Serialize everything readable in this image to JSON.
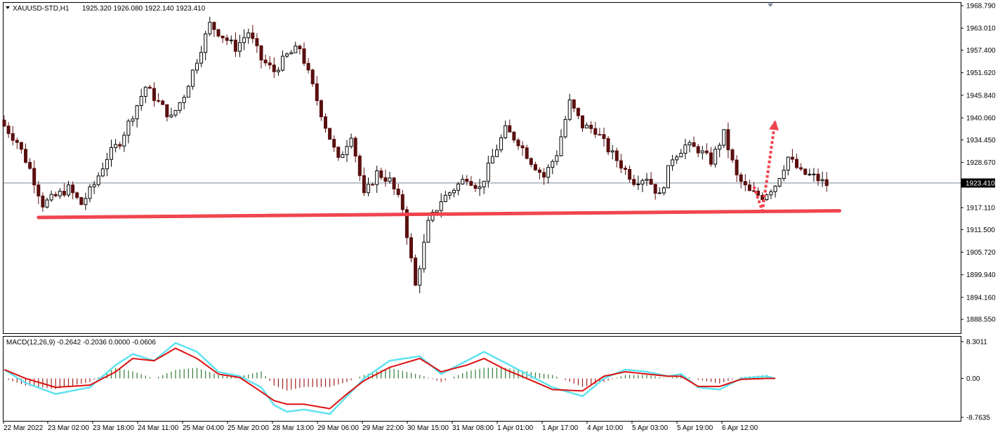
{
  "header": {
    "symbol": "XAUUSD-STD,H1",
    "ohlc": "1925.320 1926.080 1922.140 1923.410"
  },
  "macd_panel": {
    "label": "MACD(12,26,9) -0.2642 -0.2036 0.0000 -0.0606",
    "ticks": [
      "8.3011",
      "0.00",
      "-8.7635"
    ],
    "tick_values": [
      8.3011,
      0.0,
      -8.7635
    ]
  },
  "colors": {
    "bull": "#000000",
    "bear": "#5a0f0f",
    "support": "#f0454f",
    "macd_line": "#5fe3f0",
    "signal_line": "#dd1010",
    "hist_pos": "#2e7d32",
    "hist_neg": "#a32020",
    "price_line": "#7a8899"
  },
  "chart_data": {
    "type": "candlestick",
    "symbol": "XAUUSD-STD",
    "timeframe": "H1",
    "ylim": [
      1885.0,
      1969.5
    ],
    "y_ticks": [
      "1968.790",
      "1963.010",
      "1957.400",
      "1951.620",
      "1945.840",
      "1940.060",
      "1934.450",
      "1928.670",
      "1917.110",
      "1911.500",
      "1905.720",
      "1899.940",
      "1894.160",
      "1888.550"
    ],
    "y_tick_values": [
      1968.79,
      1963.01,
      1957.4,
      1951.62,
      1945.84,
      1940.06,
      1934.45,
      1928.67,
      1917.11,
      1911.5,
      1905.72,
      1899.94,
      1894.16,
      1888.55
    ],
    "current_price": "1923.410",
    "current_price_value": 1923.41,
    "x_labels": [
      "22 Mar 2022",
      "23 Mar 02:00",
      "23 Mar 18:00",
      "24 Mar 11:00",
      "25 Mar 04:00",
      "25 Mar 20:00",
      "28 Mar 13:00",
      "29 Mar 06:00",
      "29 Mar 22:00",
      "30 Mar 15:00",
      "31 Mar 08:00",
      "1 Apr 01:00",
      "1 Apr 17:00",
      "4 Apr 10:00",
      "5 Apr 03:00",
      "5 Apr 19:00",
      "6 Apr 12:00"
    ],
    "close_path": [
      [
        0,
        1938
      ],
      [
        3,
        1934
      ],
      [
        6,
        1927
      ],
      [
        9,
        1918
      ],
      [
        12,
        1920
      ],
      [
        15,
        1922
      ],
      [
        18,
        1918
      ],
      [
        21,
        1923
      ],
      [
        24,
        1930
      ],
      [
        27,
        1934
      ],
      [
        30,
        1941
      ],
      [
        33,
        1948
      ],
      [
        36,
        1944
      ],
      [
        39,
        1940
      ],
      [
        42,
        1946
      ],
      [
        45,
        1955
      ],
      [
        48,
        1964
      ],
      [
        51,
        1961
      ],
      [
        54,
        1958
      ],
      [
        57,
        1962
      ],
      [
        60,
        1955
      ],
      [
        63,
        1952
      ],
      [
        66,
        1956
      ],
      [
        69,
        1958
      ],
      [
        72,
        1948
      ],
      [
        75,
        1938
      ],
      [
        78,
        1929
      ],
      [
        81,
        1936
      ],
      [
        84,
        1920
      ],
      [
        87,
        1926
      ],
      [
        90,
        1924
      ],
      [
        93,
        1917
      ],
      [
        96,
        1897
      ],
      [
        99,
        1913
      ],
      [
        102,
        1919
      ],
      [
        105,
        1922
      ],
      [
        108,
        1925
      ],
      [
        111,
        1922
      ],
      [
        114,
        1930
      ],
      [
        117,
        1937
      ],
      [
        120,
        1934
      ],
      [
        123,
        1929
      ],
      [
        126,
        1925
      ],
      [
        129,
        1931
      ],
      [
        132,
        1944
      ],
      [
        135,
        1938
      ],
      [
        138,
        1937
      ],
      [
        141,
        1932
      ],
      [
        144,
        1928
      ],
      [
        147,
        1924
      ],
      [
        150,
        1925
      ],
      [
        153,
        1920
      ],
      [
        156,
        1930
      ],
      [
        159,
        1933
      ],
      [
        162,
        1932
      ],
      [
        165,
        1929
      ],
      [
        168,
        1936
      ],
      [
        171,
        1925
      ],
      [
        174,
        1921
      ],
      [
        177,
        1920
      ],
      [
        180,
        1923
      ],
      [
        183,
        1930
      ],
      [
        186,
        1926
      ],
      [
        189,
        1925
      ],
      [
        192,
        1923
      ]
    ],
    "support_line": {
      "start": [
        8,
        1914.6
      ],
      "end": [
        195,
        1916.3
      ]
    },
    "arrow_path": [
      [
        175,
        1922.5
      ],
      [
        177,
        1916.3
      ],
      [
        180,
        1939.5
      ]
    ],
    "macd": [
      [
        0,
        2
      ],
      [
        5,
        -1
      ],
      [
        12,
        -3.5
      ],
      [
        20,
        -2
      ],
      [
        26,
        3
      ],
      [
        30,
        5.5
      ],
      [
        35,
        4
      ],
      [
        40,
        8
      ],
      [
        45,
        6
      ],
      [
        50,
        1.5
      ],
      [
        55,
        0.5
      ],
      [
        60,
        -2
      ],
      [
        63,
        -6
      ],
      [
        66,
        -7.5
      ],
      [
        70,
        -7
      ],
      [
        76,
        -8
      ],
      [
        80,
        -4
      ],
      [
        84,
        0
      ],
      [
        90,
        4
      ],
      [
        97,
        5
      ],
      [
        102,
        1
      ],
      [
        108,
        4
      ],
      [
        112,
        6
      ],
      [
        117,
        3.5
      ],
      [
        122,
        1
      ],
      [
        128,
        -2
      ],
      [
        135,
        -4
      ],
      [
        140,
        0
      ],
      [
        145,
        2
      ],
      [
        150,
        1.5
      ],
      [
        155,
        0.5
      ],
      [
        158,
        1
      ],
      [
        162,
        -2
      ],
      [
        167,
        -2.5
      ],
      [
        172,
        0
      ],
      [
        178,
        0.5
      ],
      [
        180,
        0
      ]
    ],
    "signal": [
      [
        0,
        2
      ],
      [
        5,
        0
      ],
      [
        12,
        -2
      ],
      [
        20,
        -1.5
      ],
      [
        26,
        1.5
      ],
      [
        30,
        4.5
      ],
      [
        35,
        4
      ],
      [
        40,
        6.8
      ],
      [
        45,
        4.5
      ],
      [
        50,
        1
      ],
      [
        55,
        0.2
      ],
      [
        60,
        -3
      ],
      [
        63,
        -5
      ],
      [
        66,
        -5.8
      ],
      [
        70,
        -5.8
      ],
      [
        76,
        -6.8
      ],
      [
        80,
        -3.5
      ],
      [
        84,
        -0.5
      ],
      [
        90,
        2.5
      ],
      [
        97,
        4.5
      ],
      [
        102,
        1.5
      ],
      [
        108,
        3
      ],
      [
        112,
        4.5
      ],
      [
        117,
        2
      ],
      [
        122,
        0
      ],
      [
        128,
        -2.5
      ],
      [
        135,
        -2.8
      ],
      [
        140,
        0.5
      ],
      [
        145,
        1.5
      ],
      [
        150,
        1
      ],
      [
        155,
        0.5
      ],
      [
        158,
        0.5
      ],
      [
        162,
        -1.8
      ],
      [
        167,
        -1.8
      ],
      [
        172,
        -0.2
      ],
      [
        178,
        0
      ],
      [
        180,
        0
      ]
    ]
  }
}
